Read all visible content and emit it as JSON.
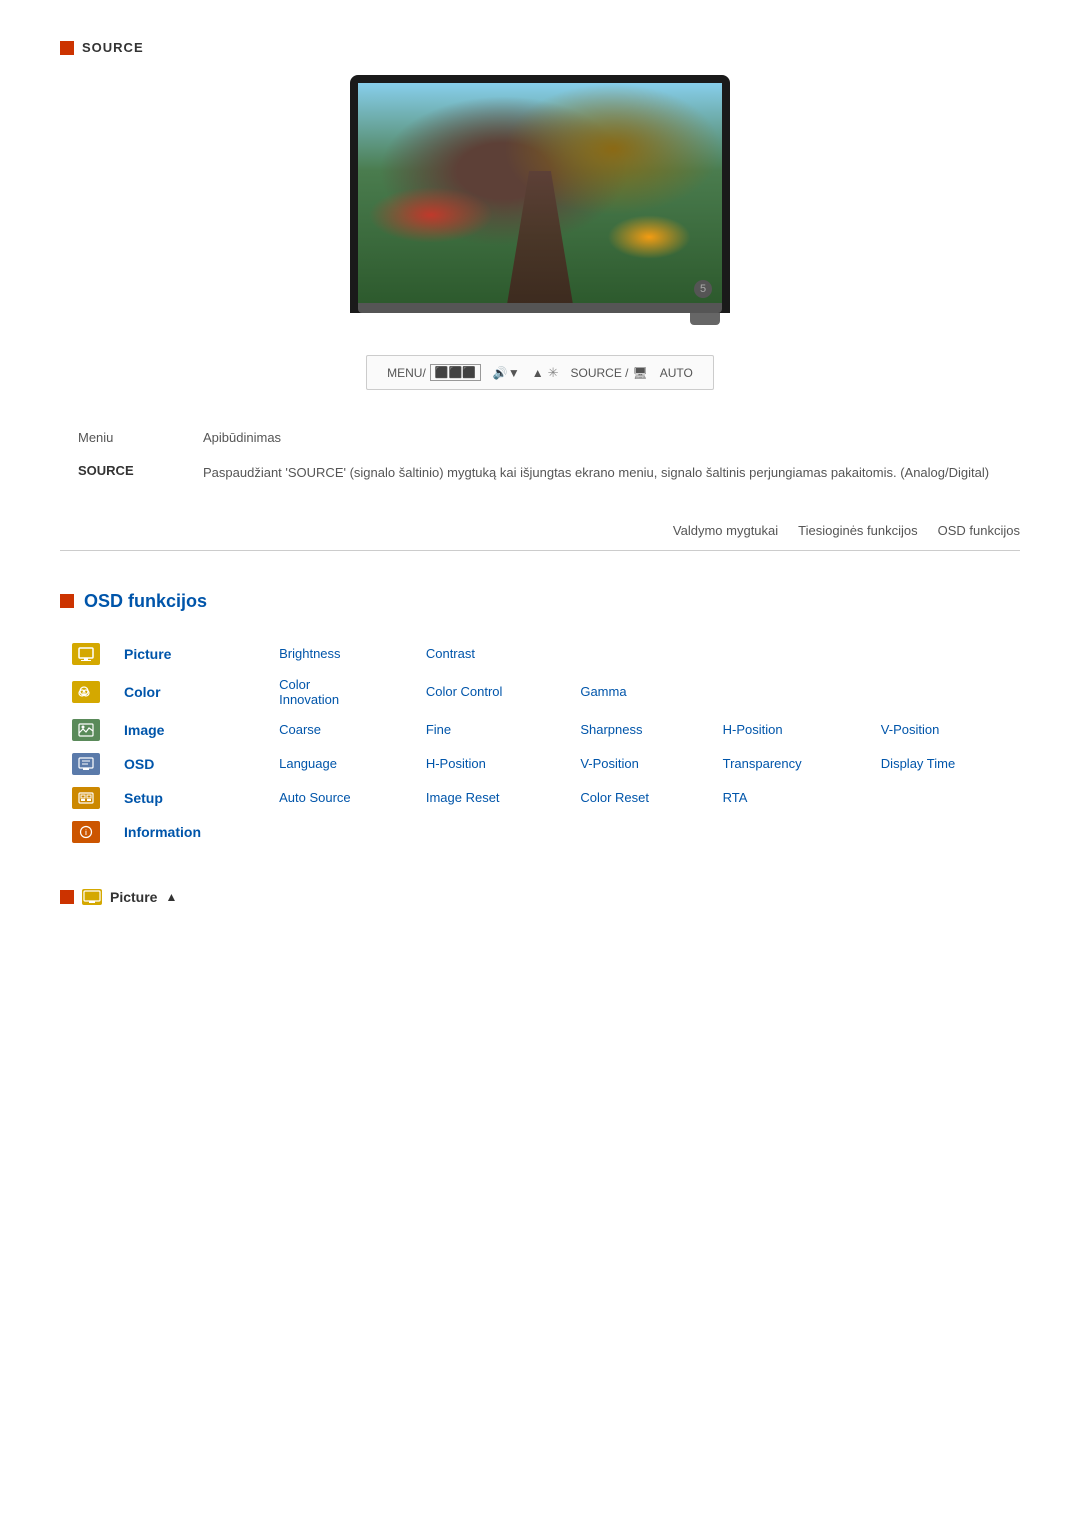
{
  "source_section": {
    "icon_label": "source-icon",
    "title": "SOURCE"
  },
  "monitor": {
    "number": "5"
  },
  "control_bar": {
    "menu_label": "MENU/",
    "source_label": "SOURCE /",
    "auto_label": "AUTO"
  },
  "description": {
    "col1_header": "Meniu",
    "col2_header": "Apibūdinimas",
    "row1_label": "SOURCE",
    "row1_text": "Paspaudžiant 'SOURCE' (signalo šaltinio) mygtuką kai išjungtas ekrano meniu, signalo šaltinis perjungiamas pakaitomis. (Analog/Digital)"
  },
  "nav_tabs": {
    "tab1": "Valdymo mygtukai",
    "tab2": "Tiesioginės funkcijos",
    "tab3": "OSD funkcijos"
  },
  "osd_section": {
    "title": "OSD funkcijos",
    "rows": [
      {
        "icon_code": "PIC",
        "icon_class": "icon-picture",
        "label": "Picture",
        "items": [
          "Brightness",
          "Contrast",
          "",
          "",
          ""
        ]
      },
      {
        "icon_code": "COL",
        "icon_class": "icon-color",
        "label": "Color",
        "items": [
          "Color Innovation",
          "Color Control",
          "Gamma",
          "",
          ""
        ]
      },
      {
        "icon_code": "IMG",
        "icon_class": "icon-image",
        "label": "Image",
        "items": [
          "Coarse",
          "Fine",
          "Sharpness",
          "H-Position",
          "V-Position"
        ]
      },
      {
        "icon_code": "OSD",
        "icon_class": "icon-osd",
        "label": "OSD",
        "items": [
          "Language",
          "H-Position",
          "V-Position",
          "Transparency",
          "Display Time"
        ]
      },
      {
        "icon_code": "SET",
        "icon_class": "icon-setup",
        "label": "Setup",
        "items": [
          "Auto Source",
          "Image Reset",
          "Color Reset",
          "RTA",
          ""
        ]
      },
      {
        "icon_code": "INF",
        "icon_class": "icon-info",
        "label": "Information",
        "items": [
          "",
          "",
          "",
          "",
          ""
        ]
      }
    ]
  },
  "footer": {
    "icon_code": "PIC",
    "label": "Picture"
  }
}
